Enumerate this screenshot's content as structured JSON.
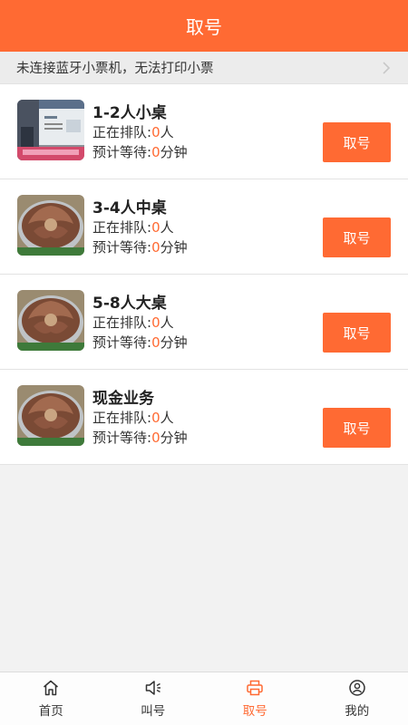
{
  "header": {
    "title": "取号"
  },
  "notice": {
    "text": "未连接蓝牙小票机，无法打印小票"
  },
  "queue_labels": {
    "waiting_prefix": "正在排队:",
    "waiting_unit": "人",
    "eta_prefix": "预计等待:",
    "eta_unit": "分钟"
  },
  "tables": [
    {
      "title": "1-2人小桌",
      "waiting": "0",
      "eta": "0",
      "button": "取号",
      "image": "store-photo"
    },
    {
      "title": "3-4人中桌",
      "waiting": "0",
      "eta": "0",
      "button": "取号",
      "image": "grill-dish-photo"
    },
    {
      "title": "5-8人大桌",
      "waiting": "0",
      "eta": "0",
      "button": "取号",
      "image": "grill-dish-photo"
    },
    {
      "title": "现金业务",
      "waiting": "0",
      "eta": "0",
      "button": "取号",
      "image": "grill-dish-photo"
    }
  ],
  "tabbar": {
    "items": [
      {
        "label": "首页",
        "icon": "home-icon",
        "active": false
      },
      {
        "label": "叫号",
        "icon": "speaker-icon",
        "active": false
      },
      {
        "label": "取号",
        "icon": "printer-icon",
        "active": true
      },
      {
        "label": "我的",
        "icon": "user-icon",
        "active": false
      }
    ]
  },
  "colors": {
    "accent": "#ff6a33"
  }
}
